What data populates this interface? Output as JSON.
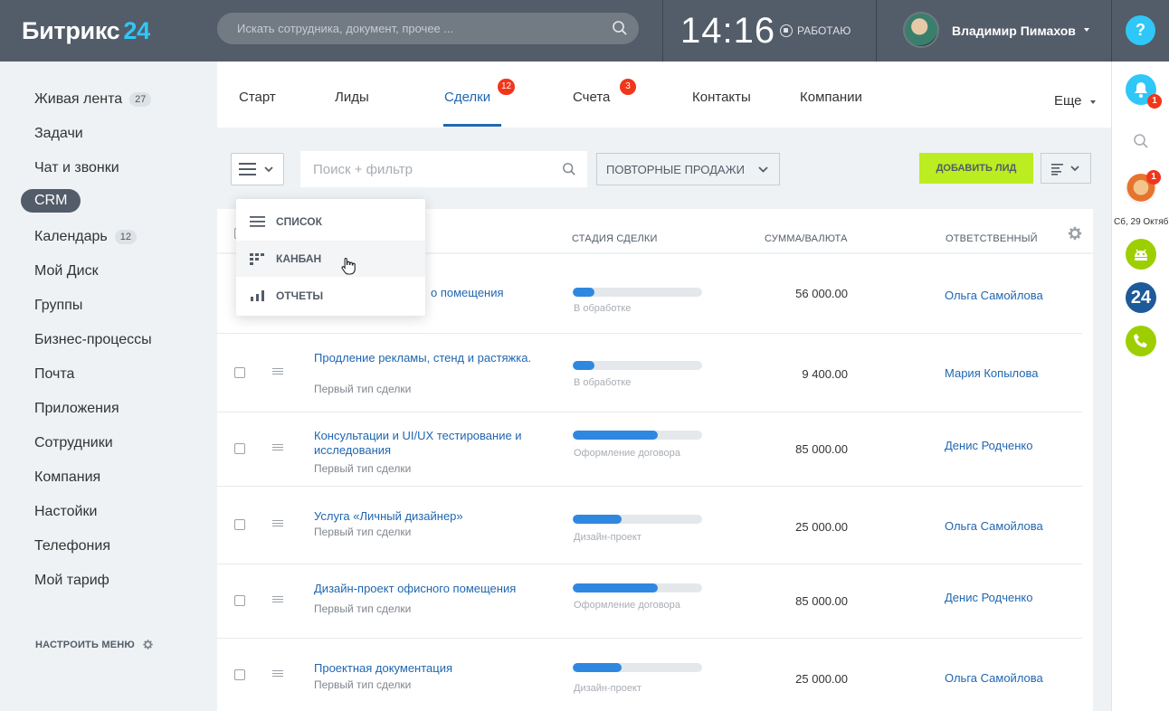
{
  "header": {
    "logo_text": "Битрикс",
    "logo_num": "24",
    "search_placeholder": "Искать сотрудника, документ, прочее ...",
    "clock": "14:16",
    "work_status": "РАБОТАЮ",
    "user_name": "Владимир Пимахов",
    "help": "?"
  },
  "leftmenu": {
    "items": [
      {
        "label": "Живая лента",
        "count": "27"
      },
      {
        "label": "Задачи",
        "count": ""
      },
      {
        "label": "Чат и звонки",
        "count": ""
      },
      {
        "label": "CRM",
        "count": ""
      },
      {
        "label": "Календарь",
        "count": "12"
      },
      {
        "label": "Мой Диск",
        "count": ""
      },
      {
        "label": "Группы",
        "count": ""
      },
      {
        "label": "Бизнес-процессы",
        "count": ""
      },
      {
        "label": "Почта",
        "count": ""
      },
      {
        "label": "Приложения",
        "count": ""
      },
      {
        "label": "Сотрудники",
        "count": ""
      },
      {
        "label": "Компания",
        "count": ""
      },
      {
        "label": "Настойки",
        "count": ""
      },
      {
        "label": "Телефония",
        "count": ""
      },
      {
        "label": "Мой тариф",
        "count": ""
      }
    ],
    "setup_label": "НАСТРОИТЬ МЕНЮ"
  },
  "tabs": {
    "items": [
      {
        "label": "Старт",
        "badge": ""
      },
      {
        "label": "Лиды",
        "badge": ""
      },
      {
        "label": "Сделки",
        "badge": "12"
      },
      {
        "label": "Счета",
        "badge": "3"
      },
      {
        "label": "Контакты",
        "badge": ""
      },
      {
        "label": "Компании",
        "badge": ""
      }
    ],
    "more": "Еще"
  },
  "toolbar": {
    "filter_placeholder": "Поиск + фильтр",
    "preset": "ПОВТОРНЫЕ ПРОДАЖИ",
    "add_label": "ДОБАВИТЬ ЛИД"
  },
  "grid": {
    "columns": {
      "stage": "СТАДИЯ СДЕЛКИ",
      "amount": "СУММА/ВАЛЮТА",
      "responsible": "ОТВЕТСТВЕННЫЙ"
    },
    "rows": [
      {
        "name": "о помещения",
        "type": "",
        "stage": "В обработке",
        "progress": 0.17,
        "amount": "56 000.00",
        "responsible": "Ольга Самойлова"
      },
      {
        "name": "Продление рекламы, стенд и растяжка.",
        "type": "Первый тип сделки",
        "stage": "В обработке",
        "progress": 0.17,
        "amount": "9 400.00",
        "responsible": "Мария Копылова"
      },
      {
        "name": "Консультации и UI/UX тестирование и исследования",
        "type": "Первый тип сделки",
        "stage": "Оформление договора",
        "progress": 0.66,
        "amount": "85 000.00",
        "responsible": "Денис Родченко"
      },
      {
        "name": "Услуга «Личный дизайнер»",
        "type": "Первый тип сделки",
        "stage": "Дизайн-проект",
        "progress": 0.38,
        "amount": "25 000.00",
        "responsible": "Ольга Самойлова"
      },
      {
        "name": "Дизайн-проект офисного помещения",
        "type": "Первый тип сделки",
        "stage": "Оформление договора",
        "progress": 0.66,
        "amount": "85 000.00",
        "responsible": "Денис Родченко"
      },
      {
        "name": "Проектная документация",
        "type": "Первый тип сделки",
        "stage": "Дизайн-проект",
        "progress": 0.38,
        "amount": "25 000.00",
        "responsible": "Ольга Самойлова"
      }
    ]
  },
  "view_menu": {
    "items": [
      {
        "label": "СПИСОК"
      },
      {
        "label": "КАНБАН"
      },
      {
        "label": "ОТЧЕТЫ"
      }
    ]
  },
  "rightbar": {
    "notif_count": "1",
    "chat_count": "1",
    "date": "Сб, 29 Октяб",
    "b24": "24"
  },
  "colors": {
    "header_bg": "#535c69",
    "accent_blue": "#2fc7f7",
    "link_blue": "#2067b0",
    "add_button": "#bbed21",
    "badge_red": "#f1361b",
    "progress_blue": "#2f88e0"
  }
}
